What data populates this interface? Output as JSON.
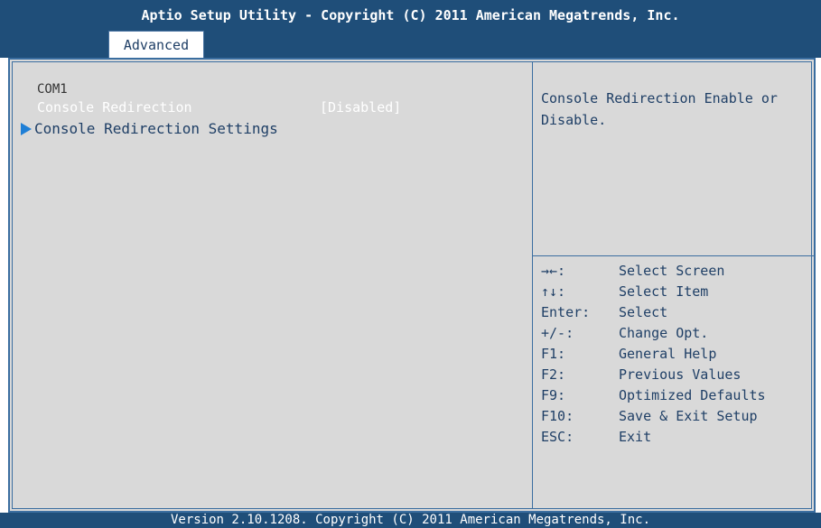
{
  "header": {
    "title": "Aptio Setup Utility - Copyright (C) 2011 American Megatrends, Inc.",
    "active_tab": "Advanced"
  },
  "main": {
    "section_label": "COM1",
    "items": [
      {
        "label": "Console Redirection",
        "value": "[Disabled]"
      }
    ],
    "submenu": {
      "label": "Console Redirection Settings"
    }
  },
  "help": {
    "text": "Console Redirection Enable or Disable."
  },
  "keys": [
    {
      "key": "→←:",
      "desc": "Select Screen"
    },
    {
      "key": "↑↓:",
      "desc": "Select Item"
    },
    {
      "key": "Enter:",
      "desc": "Select"
    },
    {
      "key": "+/-:",
      "desc": "Change Opt."
    },
    {
      "key": "F1:",
      "desc": "General Help"
    },
    {
      "key": "F2:",
      "desc": "Previous Values"
    },
    {
      "key": "F9:",
      "desc": "Optimized Defaults"
    },
    {
      "key": "F10:",
      "desc": "Save & Exit Setup"
    },
    {
      "key": "ESC:",
      "desc": "Exit"
    }
  ],
  "footer": {
    "version": "Version 2.10.1208. Copyright (C) 2011 American Megatrends, Inc."
  },
  "colors": {
    "header_bg": "#1f4e79",
    "panel_bg": "#d9d9d9",
    "text_blue": "#1f3f66",
    "arrow_blue": "#1f7fd6"
  }
}
